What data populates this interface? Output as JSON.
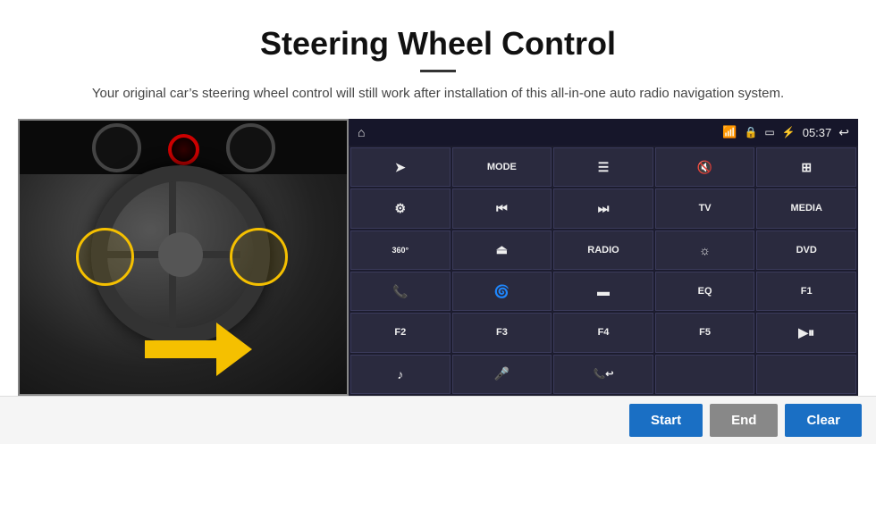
{
  "header": {
    "title": "Steering Wheel Control",
    "subtitle": "Your original car’s steering wheel control will still work after installation of this all-in-one auto radio navigation system."
  },
  "status_bar": {
    "time": "05:37",
    "wifi_icon": "wifi-icon",
    "lock_icon": "lock-icon",
    "sd_icon": "sd-icon",
    "bt_icon": "bluetooth-icon",
    "home_icon": "home-icon",
    "back_icon": "back-icon"
  },
  "buttons": [
    {
      "label": "",
      "icon": "navigate-icon",
      "row": 1,
      "col": 1
    },
    {
      "label": "MODE",
      "icon": "",
      "row": 1,
      "col": 2
    },
    {
      "label": "",
      "icon": "list-icon",
      "row": 1,
      "col": 3
    },
    {
      "label": "",
      "icon": "volume-mute-icon",
      "row": 1,
      "col": 4
    },
    {
      "label": "",
      "icon": "grid-icon",
      "row": 1,
      "col": 5
    },
    {
      "label": "",
      "icon": "settings-icon",
      "row": 2,
      "col": 1
    },
    {
      "label": "",
      "icon": "prev-icon",
      "row": 2,
      "col": 2
    },
    {
      "label": "",
      "icon": "next-icon",
      "row": 2,
      "col": 3
    },
    {
      "label": "TV",
      "icon": "",
      "row": 2,
      "col": 4
    },
    {
      "label": "MEDIA",
      "icon": "",
      "row": 2,
      "col": 5
    },
    {
      "label": "",
      "icon": "360-icon",
      "row": 3,
      "col": 1
    },
    {
      "label": "",
      "icon": "eject-icon",
      "row": 3,
      "col": 2
    },
    {
      "label": "RADIO",
      "icon": "",
      "row": 3,
      "col": 3
    },
    {
      "label": "",
      "icon": "brightness-icon",
      "row": 3,
      "col": 4
    },
    {
      "label": "DVD",
      "icon": "",
      "row": 3,
      "col": 5
    },
    {
      "label": "",
      "icon": "phone-icon",
      "row": 4,
      "col": 1
    },
    {
      "label": "",
      "icon": "ie-icon",
      "row": 4,
      "col": 2
    },
    {
      "label": "",
      "icon": "rectangle-icon",
      "row": 4,
      "col": 3
    },
    {
      "label": "EQ",
      "icon": "",
      "row": 4,
      "col": 4
    },
    {
      "label": "F1",
      "icon": "",
      "row": 4,
      "col": 5
    },
    {
      "label": "F2",
      "icon": "",
      "row": 5,
      "col": 1
    },
    {
      "label": "F3",
      "icon": "",
      "row": 5,
      "col": 2
    },
    {
      "label": "F4",
      "icon": "",
      "row": 5,
      "col": 3
    },
    {
      "label": "F5",
      "icon": "",
      "row": 5,
      "col": 4
    },
    {
      "label": "",
      "icon": "play-pause-icon",
      "row": 5,
      "col": 5
    },
    {
      "label": "",
      "icon": "music-icon",
      "row": 6,
      "col": 1
    },
    {
      "label": "",
      "icon": "mic-icon",
      "row": 6,
      "col": 2
    },
    {
      "label": "",
      "icon": "call-end-icon",
      "row": 6,
      "col": 3
    },
    {
      "label": "",
      "icon": "",
      "row": 6,
      "col": 4
    },
    {
      "label": "",
      "icon": "",
      "row": 6,
      "col": 5
    }
  ],
  "bottom_bar": {
    "start_label": "Start",
    "end_label": "End",
    "clear_label": "Clear"
  }
}
